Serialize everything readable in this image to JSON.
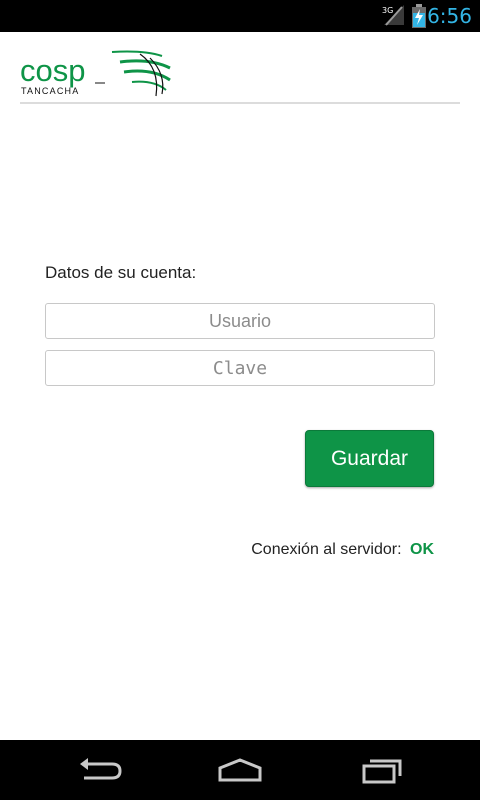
{
  "status_bar": {
    "network": "3G",
    "time": "6:56",
    "accent_color": "#33b5e5"
  },
  "header": {
    "logo_text": "cosp",
    "logo_subtext": "TANCACHA",
    "brand_color": "#0e9447"
  },
  "form": {
    "account_label": "Datos de su cuenta:",
    "username": {
      "value": "",
      "placeholder": "Usuario"
    },
    "password": {
      "value": "",
      "placeholder": "Clave"
    },
    "save_label": "Guardar"
  },
  "connection": {
    "label": "Conexión al servidor:",
    "value": "OK",
    "status_color": "#0e9447"
  },
  "nav_bar": {
    "icons": [
      "back-icon",
      "home-icon",
      "recents-icon"
    ]
  }
}
